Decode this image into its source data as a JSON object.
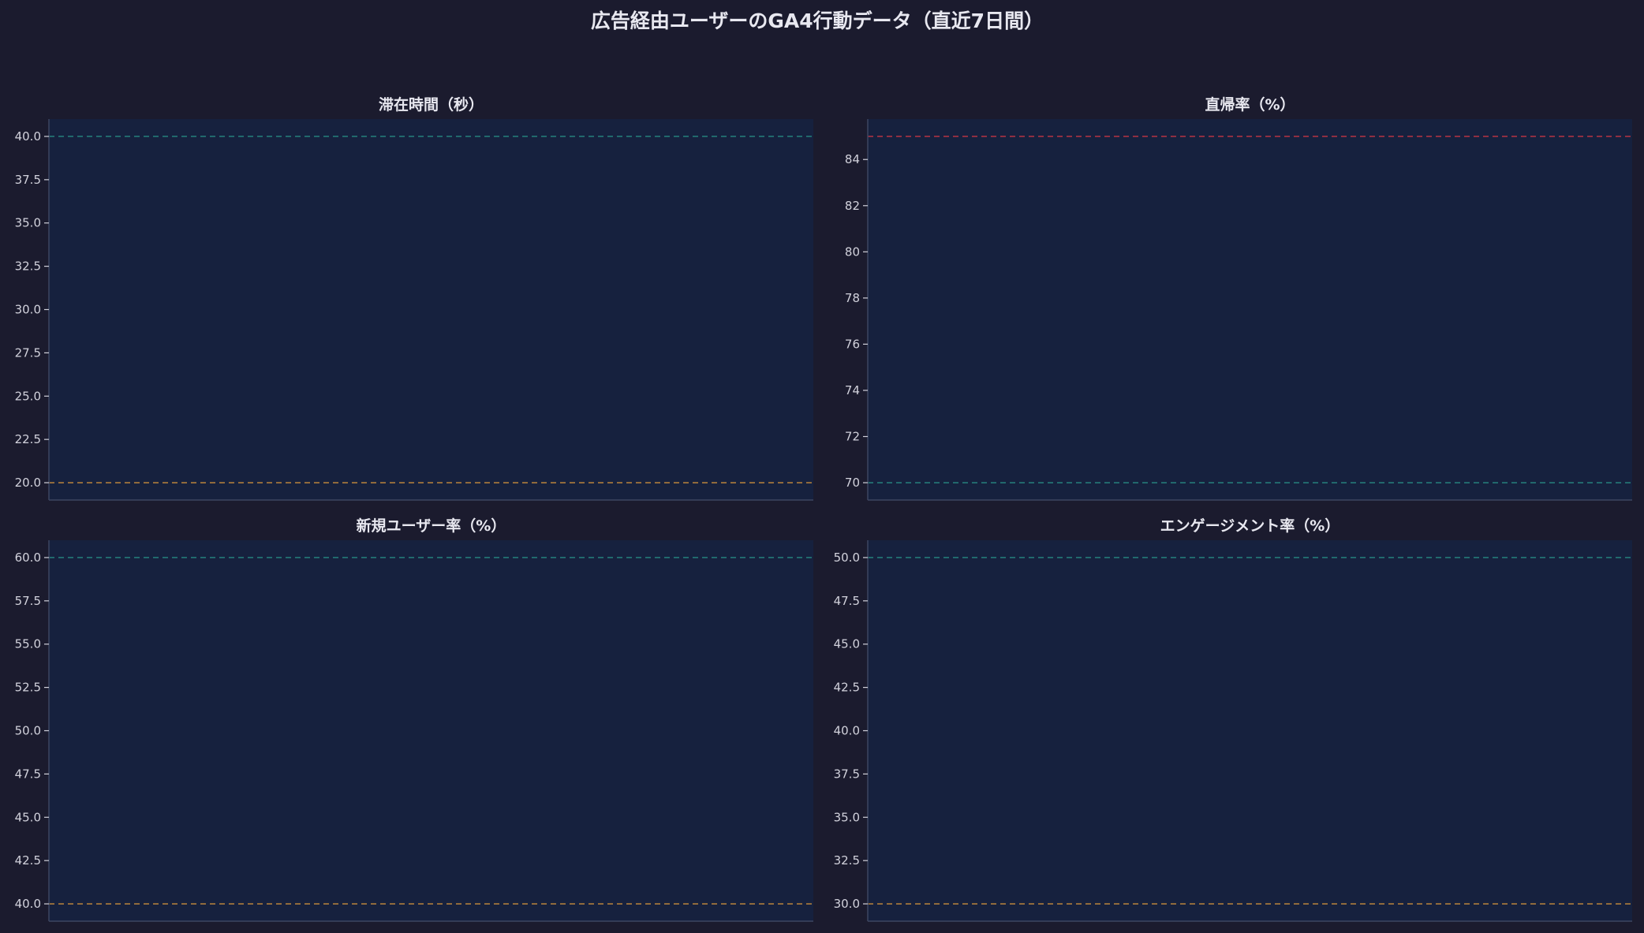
{
  "figure": {
    "title": "広告経由ユーザーのGA4行動データ（直近7日間）"
  },
  "colors": {
    "background": "#1b1b2e",
    "plot_background": "#16213e",
    "good": "#2a9d8f",
    "warning": "#e9a23b",
    "bad": "#e63946"
  },
  "chart_data": [
    {
      "type": "line",
      "title": "滞在時間（秒）",
      "xlabel": "",
      "ylabel": "",
      "series": [],
      "ylim": [
        19.0,
        41.0
      ],
      "yticks": [
        20.0,
        22.5,
        25.0,
        27.5,
        30.0,
        32.5,
        35.0,
        37.5,
        40.0
      ],
      "tick_decimals": 1,
      "reference_lines": [
        {
          "value": 40.0,
          "color": "#2a9d8f"
        },
        {
          "value": 20.0,
          "color": "#e9a23b"
        }
      ],
      "grid": false
    },
    {
      "type": "line",
      "title": "直帰率（%）",
      "xlabel": "",
      "ylabel": "",
      "series": [],
      "ylim": [
        69.25,
        85.75
      ],
      "yticks": [
        70,
        72,
        74,
        76,
        78,
        80,
        82,
        84
      ],
      "tick_decimals": 0,
      "reference_lines": [
        {
          "value": 85,
          "color": "#e63946"
        },
        {
          "value": 70,
          "color": "#2a9d8f"
        }
      ],
      "grid": false
    },
    {
      "type": "line",
      "title": "新規ユーザー率（%）",
      "xlabel": "",
      "ylabel": "",
      "series": [],
      "ylim": [
        39.0,
        61.0
      ],
      "yticks": [
        40.0,
        42.5,
        45.0,
        47.5,
        50.0,
        52.5,
        55.0,
        57.5,
        60.0
      ],
      "tick_decimals": 1,
      "reference_lines": [
        {
          "value": 60.0,
          "color": "#2a9d8f"
        },
        {
          "value": 40.0,
          "color": "#e9a23b"
        }
      ],
      "grid": false
    },
    {
      "type": "line",
      "title": "エンゲージメント率（%）",
      "xlabel": "",
      "ylabel": "",
      "series": [],
      "ylim": [
        29.0,
        51.0
      ],
      "yticks": [
        30.0,
        32.5,
        35.0,
        37.5,
        40.0,
        42.5,
        45.0,
        47.5,
        50.0
      ],
      "tick_decimals": 1,
      "reference_lines": [
        {
          "value": 50.0,
          "color": "#2a9d8f"
        },
        {
          "value": 30.0,
          "color": "#e9a23b"
        }
      ],
      "grid": false
    }
  ]
}
